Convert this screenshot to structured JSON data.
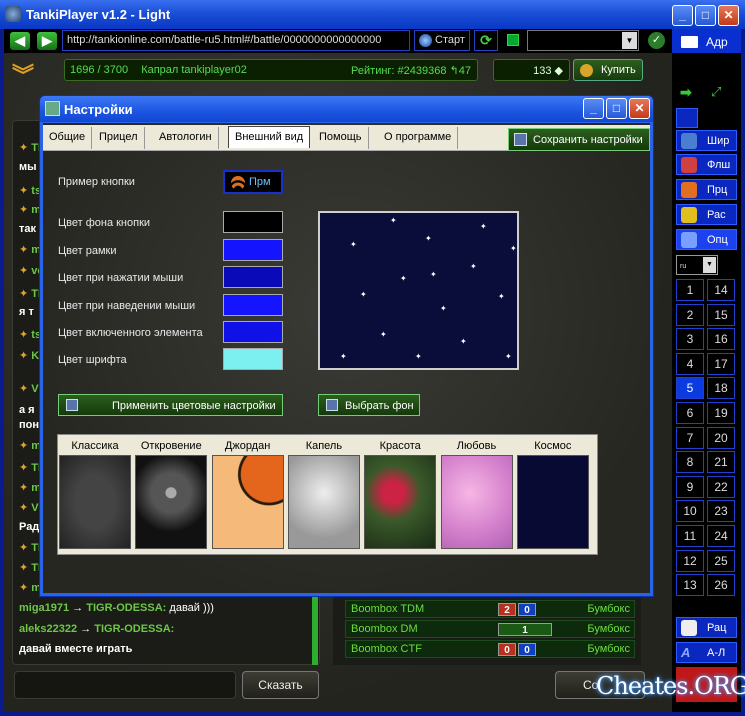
{
  "window": {
    "title": "TankiPlayer v1.2 - Light",
    "minimize": "_",
    "maximize": "□",
    "close": "✕"
  },
  "toolbar": {
    "back": "◀",
    "forward": "▶",
    "url": "http://tankionline.com/battle-ru5.html#/battle/0000000000000000",
    "start_label": "Старт",
    "refresh": "⟳",
    "combo_arrow": "▼",
    "check": "✓",
    "adr_label": "Адр"
  },
  "stats": {
    "experience": "1696 / 3700",
    "rank_player": "Капрал tankiplayer02",
    "rating": "Рейтинг: #2439368 ↰47",
    "crystals": "133 ◆",
    "buy_label": "Купить"
  },
  "chevron": "︾",
  "chat": {
    "lines": [
      {
        "text": "TI",
        "type": "n"
      },
      {
        "text": "мы",
        "type": "b"
      },
      {
        "text": "ts",
        "type": "n"
      },
      {
        "text": "m",
        "type": "n"
      },
      {
        "text": "так",
        "type": "b"
      },
      {
        "text": "m",
        "type": "n"
      },
      {
        "text": "vc",
        "type": "n"
      },
      {
        "text": "TI",
        "type": "n"
      },
      {
        "text": "я т",
        "type": "b"
      },
      {
        "text": "ts",
        "type": "n"
      },
      {
        "text": "Ki",
        "type": "n"
      },
      {
        "text": "V",
        "type": "n"
      },
      {
        "text": "а я",
        "type": "b"
      },
      {
        "text": "пон",
        "type": "b"
      },
      {
        "text": "m",
        "type": "n"
      },
      {
        "text": "TI",
        "type": "n"
      },
      {
        "text": "m",
        "type": "n"
      },
      {
        "text": "V",
        "type": "n"
      },
      {
        "text": "Рад",
        "type": "b"
      },
      {
        "text": "TI",
        "type": "n"
      },
      {
        "text": "TI",
        "type": "n"
      },
      {
        "text": "m",
        "type": "n"
      }
    ],
    "msg1_from": "miga1971",
    "msg1_to": "TIGR-ODESSA:",
    "msg1_text": "давай )))",
    "msg2_from": "aleks22322",
    "msg2_to": "TIGR-ODESSA:",
    "msg2_text": "давай вместе играть",
    "arrow": "→",
    "say_label": "Сказать"
  },
  "battles": [
    {
      "name": "Boombox TDM",
      "s1": "2",
      "s2": "0",
      "c1": "#b83020",
      "c2": "#1040c0",
      "mode": "Бумбокс"
    },
    {
      "name": "Boombox DM",
      "s1": "1",
      "s2": "",
      "c1": "#1a5a14",
      "c2": "",
      "mode": "Бумбокс"
    },
    {
      "name": "Boombox CTF",
      "s1": "0",
      "s2": "0",
      "c1": "#b83020",
      "c2": "#1040c0",
      "mode": "Бумбокс"
    }
  ],
  "create_label": "Со",
  "sidebar": {
    "top_icons": [
      "arrow-right-icon",
      "fullscreen-icon"
    ],
    "buttons": [
      {
        "label": "Шир",
        "icon": "camera-icon",
        "color": "#4a7fd0"
      },
      {
        "label": "Флш",
        "icon": "chart-icon",
        "color": "#d04040"
      },
      {
        "label": "Прц",
        "icon": "radar-icon",
        "color": "#e07020"
      },
      {
        "label": "Рас",
        "icon": "star-icon",
        "color": "#e0c020"
      },
      {
        "label": "Опц",
        "icon": "gear-icon",
        "color": "#7aa0ff"
      }
    ],
    "lang": "ru",
    "lang_arrow": "▼",
    "numbers_left": [
      "1",
      "2",
      "3",
      "4",
      "5",
      "6",
      "7",
      "8",
      "9",
      "10",
      "11",
      "12",
      "13"
    ],
    "numbers_right": [
      "14",
      "15",
      "16",
      "17",
      "18",
      "19",
      "20",
      "21",
      "22",
      "23",
      "24",
      "25",
      "26"
    ],
    "active_number": "5",
    "bottom": [
      {
        "label": "Рац",
        "icon": "cup-icon"
      },
      {
        "label": "А-Л",
        "icon": "font-icon"
      }
    ]
  },
  "watermark": "Cheates.ORG",
  "dialog": {
    "title": "Настройки",
    "tabs": [
      "Общие",
      "Прицел",
      "Автологин",
      "Внешний вид",
      "Помощь",
      "О программе"
    ],
    "selected_tab": "Внешний вид",
    "save_label": "Сохранить настройки",
    "example_label": "Пример кнопки",
    "example_button": "Прм",
    "colors": [
      {
        "label": "Цвет фона кнопки",
        "value": "#000000"
      },
      {
        "label": "Цвет рамки",
        "value": "#1414ff"
      },
      {
        "label": "Цвет при нажатии мыши",
        "value": "#0a0ab8"
      },
      {
        "label": "Цвет при наведении мыши",
        "value": "#1414ff"
      },
      {
        "label": "Цвет включенного элемента",
        "value": "#1010e8"
      },
      {
        "label": "Цвет шрифта",
        "value": "#7cf0f0"
      }
    ],
    "apply_label": "Применить цветовые настройки",
    "choose_bg_label": "Выбрать фон",
    "themes": [
      "Классика",
      "Откровение",
      "Джордан",
      "Капель",
      "Красота",
      "Любовь",
      "Космос"
    ]
  }
}
